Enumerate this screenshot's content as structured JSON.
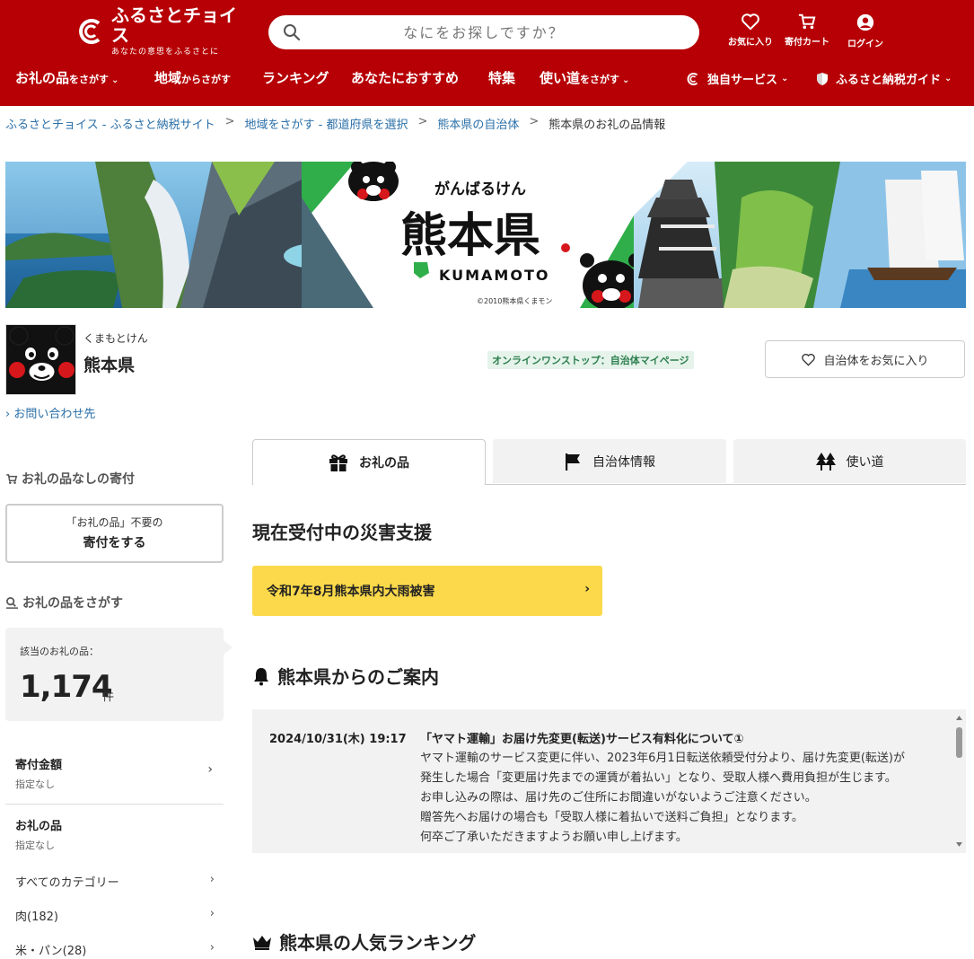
{
  "header": {
    "logo_name": "ふるさとチョイス",
    "logo_tagline": "あなたの意思をふるさとに",
    "search_placeholder": "なにをお探しですか？",
    "favorites_label": "お気に入り",
    "cart_label": "寄付カート",
    "login_label": "ログイン"
  },
  "nav": {
    "items": [
      {
        "main": "お礼の品",
        "sub": "をさがす",
        "chev": "⌄"
      },
      {
        "main": "地域",
        "sub": "からさがす",
        "chev": ""
      },
      {
        "main": "ランキング",
        "sub": "",
        "chev": ""
      },
      {
        "main": "あなたにおすすめ",
        "sub": "",
        "chev": ""
      },
      {
        "main": "特集",
        "sub": "",
        "chev": ""
      },
      {
        "main": "使い道",
        "sub": "をさがす",
        "chev": "⌄"
      }
    ],
    "original_service": "独自サービス",
    "tax_guide": "ふるさと納税ガイド"
  },
  "breadcrumb": {
    "items": [
      "ふるさとチョイス - ふるさと納税サイト",
      "地域をさがす - 都道府県を選択",
      "熊本県の自治体"
    ],
    "current": "熊本県のお礼の品情報",
    "separator": ">"
  },
  "banner": {
    "catch": "がんばるけん",
    "title": "熊本県",
    "roman": "KUMAMOTO",
    "copyright": "©2010熊本県くまモン"
  },
  "municipality": {
    "kana": "くまもとけん",
    "name": "熊本県",
    "onestop_badge": "オンラインワンストップ：自治体マイページ",
    "favorite_button": "自治体をお気に入り",
    "contact_link": "お問い合わせ先"
  },
  "sidebar": {
    "no_return_heading": "お礼の品なしの寄付",
    "no_return_button_line1": "「お礼の品」不要の",
    "no_return_button_line2": "寄付をする",
    "search_heading": "お礼の品をさがす",
    "count_label": "該当のお礼の品：",
    "count_value": "1,174",
    "count_unit": "件",
    "filters": [
      {
        "title": "寄付金額",
        "value": "指定なし"
      },
      {
        "title": "お礼の品",
        "value": "指定なし"
      }
    ],
    "categories": [
      "すべてのカテゴリー",
      "肉(182)",
      "米・パン(28)"
    ]
  },
  "tabs": [
    {
      "label": "お礼の品",
      "active": true
    },
    {
      "label": "自治体情報",
      "active": false
    },
    {
      "label": "使い道",
      "active": false
    }
  ],
  "disaster": {
    "heading": "現在受付中の災害支援",
    "button": "令和7年8月熊本県内大雨被害"
  },
  "notice": {
    "heading": "熊本県からのご案内",
    "date": "2024/10/31(木) 19:17",
    "title": "「ヤマト運輸」お届け先変更(転送)サービス有料化について①",
    "body": [
      "ヤマト運輸のサービス変更に伴い、2023年6月1日転送依頼受付分より、届け先変更(転送)が",
      "発生した場合「変更届け先までの運賃が着払い」となり、受取人様へ費用負担が生じます。",
      "お申し込みの際は、届け先のご住所にお間違いがないようご注意ください。",
      "贈答先へお届けの場合も「受取人様に着払いで送料ご負担」となります。",
      "何卒ご了承いただきますようお願い申し上げます。"
    ]
  },
  "ranking": {
    "heading": "熊本県の人気ランキング"
  },
  "colors": {
    "brand_red": "#b60005",
    "link_blue": "#2a6fa8",
    "disaster_yellow": "#fbd94a",
    "onestop_green": "#2d7f4f"
  }
}
